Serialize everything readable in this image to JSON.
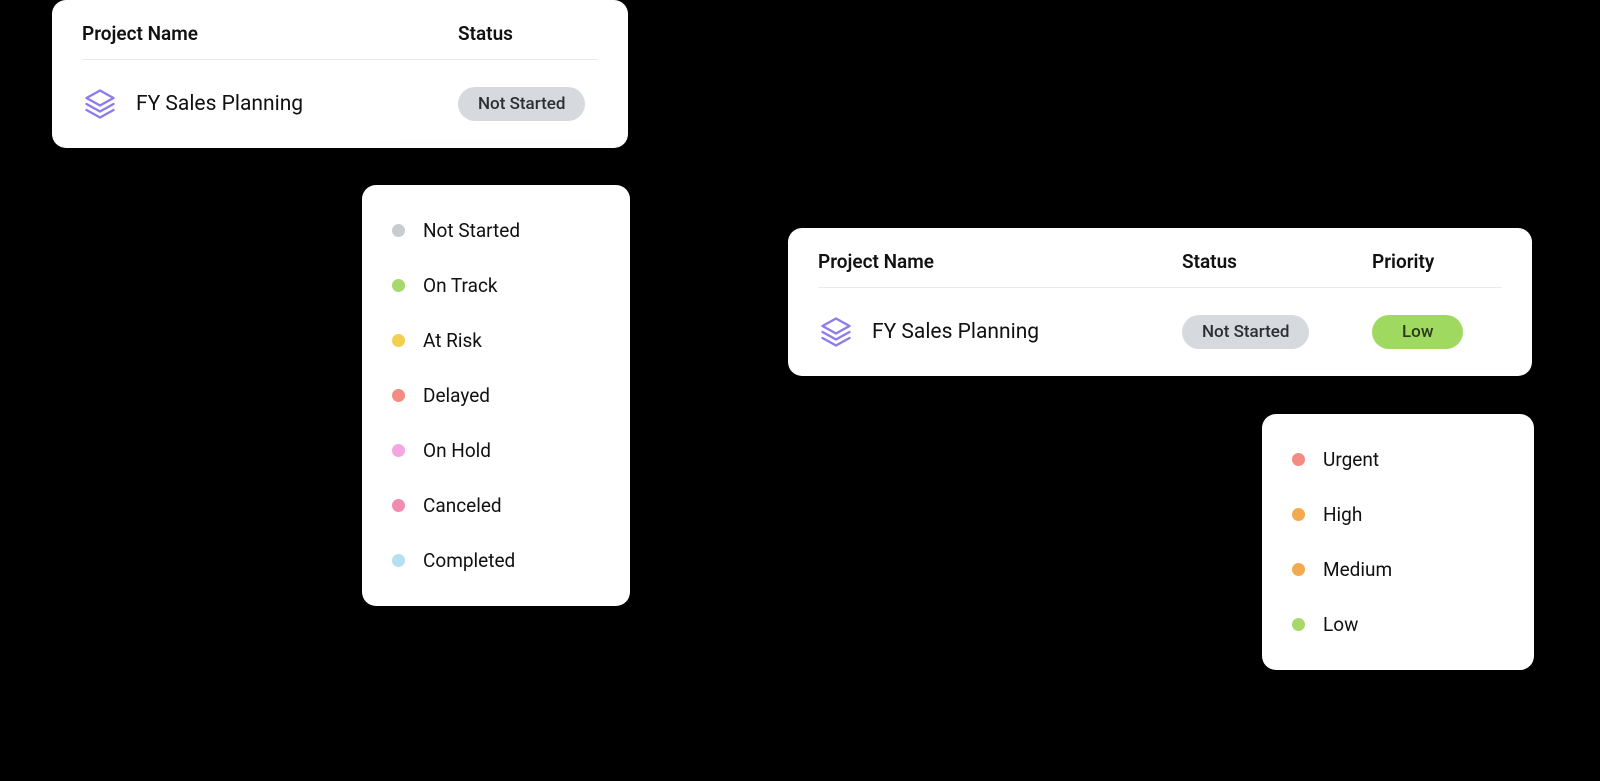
{
  "card1": {
    "headers": {
      "name": "Project Name",
      "status": "Status"
    },
    "row": {
      "name": "FY Sales Planning",
      "status": "Not Started"
    }
  },
  "card2": {
    "headers": {
      "name": "Project Name",
      "status": "Status",
      "priority": "Priority"
    },
    "row": {
      "name": "FY Sales Planning",
      "status": "Not Started",
      "priority": "Low"
    }
  },
  "status_options": [
    {
      "label": "Not Started",
      "color": "#c7ccd1"
    },
    {
      "label": "On Track",
      "color": "#a8d86b"
    },
    {
      "label": "At Risk",
      "color": "#f3cf4f"
    },
    {
      "label": "Delayed",
      "color": "#f28b82"
    },
    {
      "label": "On Hold",
      "color": "#f3a6e0"
    },
    {
      "label": "Canceled",
      "color": "#f38bb0"
    },
    {
      "label": "Completed",
      "color": "#b3e0f2"
    }
  ],
  "priority_options": [
    {
      "label": "Urgent",
      "color": "#f28b82"
    },
    {
      "label": "High",
      "color": "#f3a94f"
    },
    {
      "label": "Medium",
      "color": "#f3a94f"
    },
    {
      "label": "Low",
      "color": "#a8d86b"
    }
  ],
  "icon": {
    "name": "layers-icon",
    "color": "#8c7cf0"
  }
}
